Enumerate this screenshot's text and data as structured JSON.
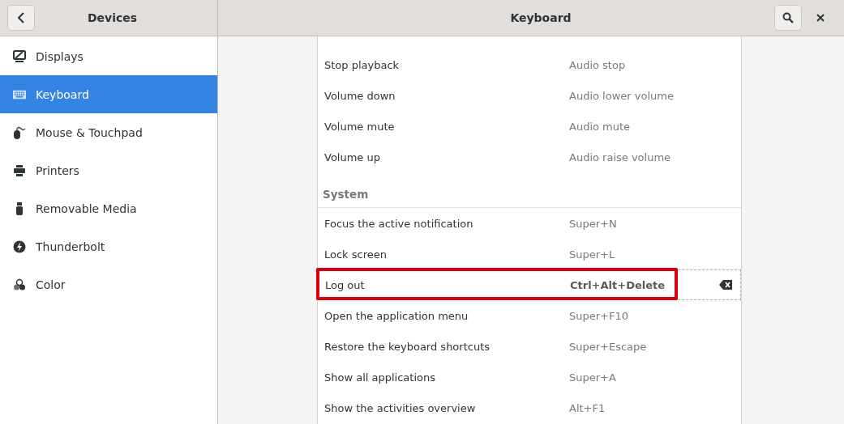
{
  "header": {
    "sidebar_title": "Devices",
    "title": "Keyboard"
  },
  "sidebar": {
    "items": [
      {
        "label": "Displays",
        "selected": false
      },
      {
        "label": "Keyboard",
        "selected": true
      },
      {
        "label": "Mouse & Touchpad",
        "selected": false
      },
      {
        "label": "Printers",
        "selected": false
      },
      {
        "label": "Removable Media",
        "selected": false
      },
      {
        "label": "Thunderbolt",
        "selected": false
      },
      {
        "label": "Color",
        "selected": false
      }
    ]
  },
  "shortcuts": [
    {
      "kind": "row",
      "name": "Stop playback",
      "accelerator": "Audio stop",
      "editing": false,
      "highlighted": false
    },
    {
      "kind": "row",
      "name": "Volume down",
      "accelerator": "Audio lower volume",
      "editing": false,
      "highlighted": false
    },
    {
      "kind": "row",
      "name": "Volume mute",
      "accelerator": "Audio mute",
      "editing": false,
      "highlighted": false
    },
    {
      "kind": "row",
      "name": "Volume up",
      "accelerator": "Audio raise volume",
      "editing": false,
      "highlighted": false
    },
    {
      "kind": "section",
      "name": "System"
    },
    {
      "kind": "row",
      "name": "Focus the active notification",
      "accelerator": "Super+N",
      "editing": false,
      "highlighted": false
    },
    {
      "kind": "row",
      "name": "Lock screen",
      "accelerator": "Super+L",
      "editing": false,
      "highlighted": false
    },
    {
      "kind": "row",
      "name": "Log out",
      "accelerator": "Ctrl+Alt+Delete",
      "editing": true,
      "highlighted": true
    },
    {
      "kind": "row",
      "name": "Open the application menu",
      "accelerator": "Super+F10",
      "editing": false,
      "highlighted": false
    },
    {
      "kind": "row",
      "name": "Restore the keyboard shortcuts",
      "accelerator": "Super+Escape",
      "editing": false,
      "highlighted": false
    },
    {
      "kind": "row",
      "name": "Show all applications",
      "accelerator": "Super+A",
      "editing": false,
      "highlighted": false
    },
    {
      "kind": "row",
      "name": "Show the activities overview",
      "accelerator": "Alt+F1",
      "editing": false,
      "highlighted": false
    }
  ]
}
